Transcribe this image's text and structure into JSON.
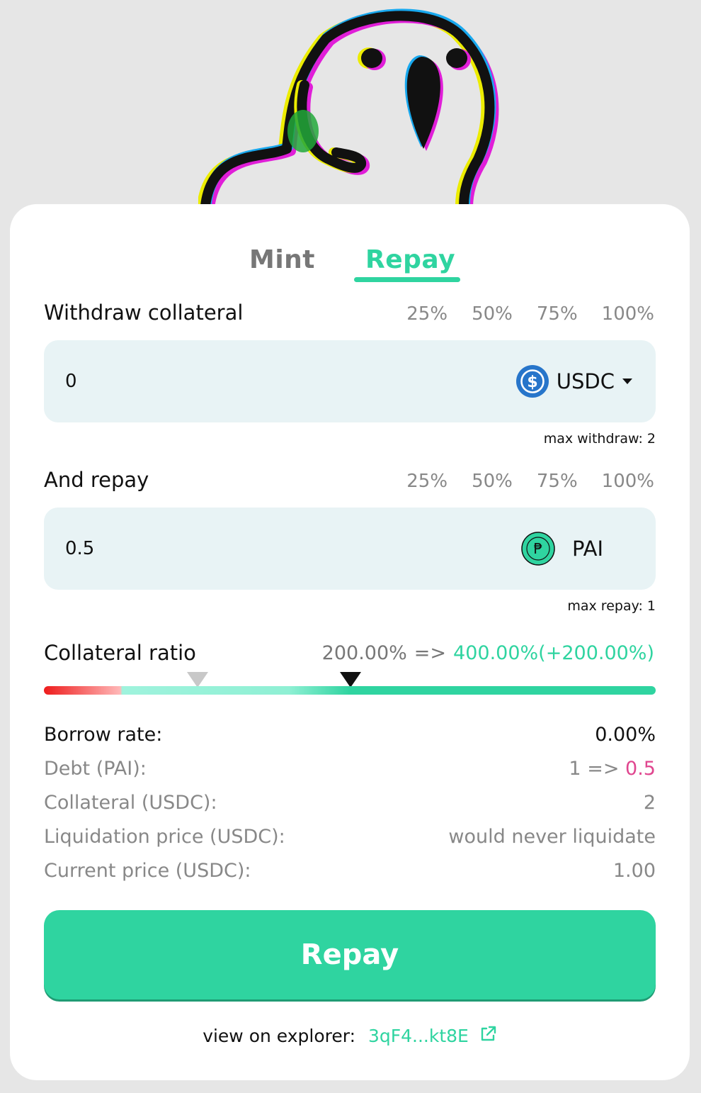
{
  "tabs": [
    {
      "label": "Mint",
      "active": false
    },
    {
      "label": "Repay",
      "active": true
    }
  ],
  "withdraw": {
    "label": "Withdraw collateral",
    "percentages": [
      "25%",
      "50%",
      "75%",
      "100%"
    ],
    "value": "0",
    "token": "USDC",
    "token_icon": "usdc-icon",
    "hint": "max withdraw: 2"
  },
  "repay": {
    "label": "And repay",
    "percentages": [
      "25%",
      "50%",
      "75%",
      "100%"
    ],
    "value": "0.5",
    "token": "PAI",
    "token_icon": "pai-icon",
    "hint": "max repay: 1"
  },
  "collateral_ratio": {
    "label": "Collateral ratio",
    "old": "200.00%",
    "arrow": "=>",
    "new": "400.00%(+200.00%)"
  },
  "stats": {
    "borrow_rate": {
      "label": "Borrow rate:",
      "value": "0.00%"
    },
    "debt": {
      "label": "Debt (PAI):",
      "old": "1",
      "arrow": "=>",
      "new": "0.5"
    },
    "collateral": {
      "label": "Collateral (USDC):",
      "value": "2"
    },
    "liquidation_price": {
      "label": "Liquidation price (USDC):",
      "value": "would never liquidate"
    },
    "current_price": {
      "label": "Current price (USDC):",
      "value": "1.00"
    }
  },
  "action_button": {
    "label": "Repay"
  },
  "explorer": {
    "label": "view on explorer:",
    "link": "3qF4...kt8E"
  },
  "colors": {
    "accent": "#2fd4a0",
    "debt_new": "#e0468f",
    "input_bg": "#e8f3f5",
    "usdc": "#2775ca"
  }
}
